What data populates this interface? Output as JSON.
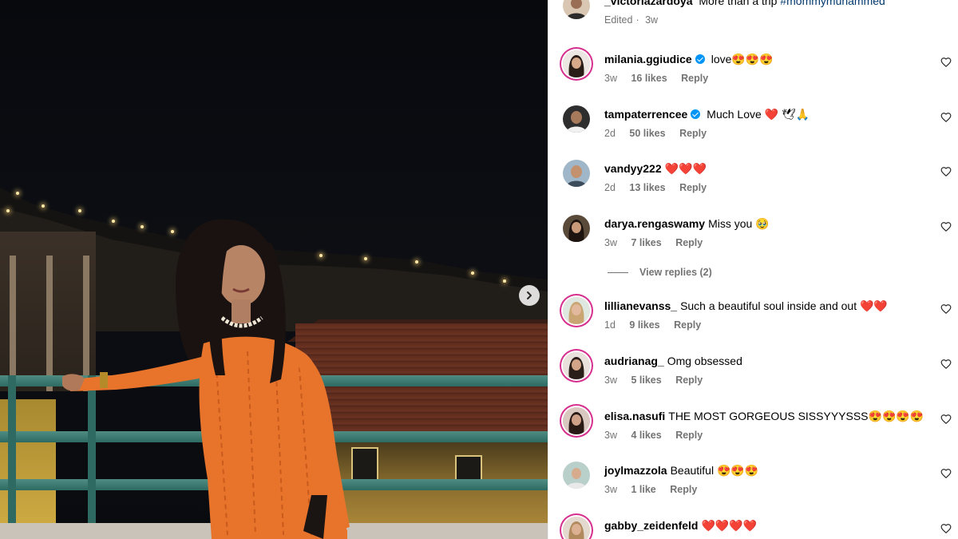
{
  "post": {
    "caption": {
      "username": "_victoriazardoya",
      "text": "More than a trip",
      "hashtag": "#mommymuhammed",
      "edited": "Edited",
      "time": "3w"
    },
    "comments": [
      {
        "username": "milania.ggiudice",
        "verified": true,
        "text": "love😍😍😍",
        "time": "3w",
        "likes": "16 likes",
        "reply": "Reply"
      },
      {
        "username": "tampaterrencee",
        "verified": true,
        "text": "Much Love ❤️ 🕊🙏",
        "time": "2d",
        "likes": "50 likes",
        "reply": "Reply"
      },
      {
        "username": "vandyy222",
        "verified": false,
        "text": "❤️❤️❤️",
        "time": "2d",
        "likes": "13 likes",
        "reply": "Reply"
      },
      {
        "username": "darya.rengaswamy",
        "verified": false,
        "text": "Miss you 🥹",
        "time": "3w",
        "likes": "7 likes",
        "reply": "Reply"
      },
      {
        "username": "lillianevanss_",
        "verified": false,
        "text": "Such a beautiful soul inside and out ❤️❤️",
        "time": "1d",
        "likes": "9 likes",
        "reply": "Reply"
      },
      {
        "username": "audrianag_",
        "verified": false,
        "text": "Omg obsessed",
        "time": "3w",
        "likes": "5 likes",
        "reply": "Reply"
      },
      {
        "username": "elisa.nasufi",
        "verified": false,
        "text": "THE MOST GORGEOUS SISSYYYSSS😍😍😍😍",
        "time": "3w",
        "likes": "4 likes",
        "reply": "Reply"
      },
      {
        "username": "joylmazzola",
        "verified": false,
        "text": "Beautiful 😍😍😍",
        "time": "3w",
        "likes": "1 like",
        "reply": "Reply"
      },
      {
        "username": "gabby_zeidenfeld",
        "verified": false,
        "text": "❤️❤️❤️❤️",
        "time": "",
        "likes": "",
        "reply": ""
      }
    ],
    "view_replies": "View replies (2)"
  },
  "icons": {
    "next": "chevron-right-icon",
    "like": "heart-outline-icon",
    "verified": "verified-badge-icon"
  },
  "colors": {
    "verified": "#0095f6",
    "hashtag": "#00376b",
    "meta": "#737373",
    "story_ring": "#d62f8e",
    "dress": "#e8742c"
  }
}
